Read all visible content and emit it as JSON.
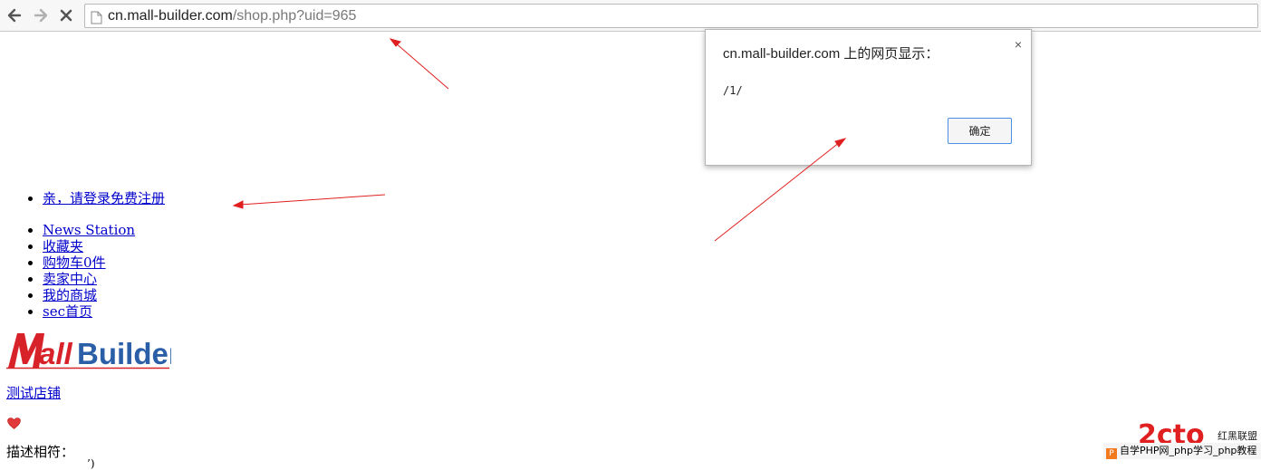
{
  "browser": {
    "url_host": "cn.mall-builder.com",
    "url_path": "/shop.php?uid=965"
  },
  "page": {
    "login_link": "亲，请登录免费注册",
    "nav_items": [
      "News Station",
      "收藏夹",
      "购物车0件",
      "卖家中心",
      "我的商城",
      "sec首页"
    ],
    "logo_text": {
      "accent": "M",
      "rest_red": "all",
      "rest_blue": "Builder"
    },
    "shop_name": "测试店铺",
    "desc_label": "描述相符：",
    "partial_bottom": "’)"
  },
  "dialog": {
    "title": "cn.mall-builder.com 上的网页显示：",
    "message": "/1/",
    "ok_label": "确定",
    "close_glyph": "×"
  },
  "watermark": {
    "logo_text": "2cto",
    "brand": "红黑联盟",
    "bar_icon": "P",
    "bar_text": "自学PHP网_php学习_php教程"
  },
  "colors": {
    "arrow": "#e02020",
    "logo_red": "#d8222a",
    "logo_blue": "#2a5fa8",
    "link": "#0000cc"
  }
}
